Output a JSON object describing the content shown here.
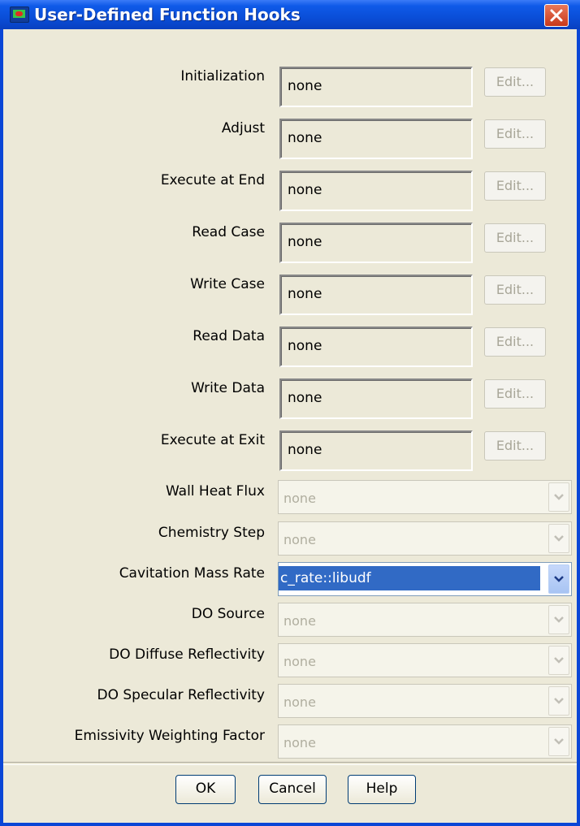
{
  "window": {
    "title": "User-Defined Function Hooks"
  },
  "text_hooks": [
    {
      "label": "Initialization",
      "value": "none",
      "button": "Edit..."
    },
    {
      "label": "Adjust",
      "value": "none",
      "button": "Edit..."
    },
    {
      "label": "Execute at End",
      "value": "none",
      "button": "Edit..."
    },
    {
      "label": "Read Case",
      "value": "none",
      "button": "Edit..."
    },
    {
      "label": "Write Case",
      "value": "none",
      "button": "Edit..."
    },
    {
      "label": "Read Data",
      "value": "none",
      "button": "Edit..."
    },
    {
      "label": "Write Data",
      "value": "none",
      "button": "Edit..."
    },
    {
      "label": "Execute at Exit",
      "value": "none",
      "button": "Edit..."
    }
  ],
  "dropdown_hooks": [
    {
      "label": "Wall Heat Flux",
      "value": "none"
    },
    {
      "label": "Chemistry Step",
      "value": "none"
    },
    {
      "label": "Cavitation Mass Rate",
      "value": "c_rate::libudf"
    },
    {
      "label": "DO Source",
      "value": "none"
    },
    {
      "label": "DO Diffuse Reflectivity",
      "value": "none"
    },
    {
      "label": "DO Specular Reflectivity",
      "value": "none"
    },
    {
      "label": "Emissivity Weighting Factor",
      "value": "none"
    }
  ],
  "buttons": {
    "ok": "OK",
    "cancel": "Cancel",
    "help": "Help"
  },
  "colors": {
    "titlebar": "#0a4ed8",
    "dialog_bg": "#ece9d8",
    "selection": "#316ac5",
    "close": "#d8482a"
  }
}
